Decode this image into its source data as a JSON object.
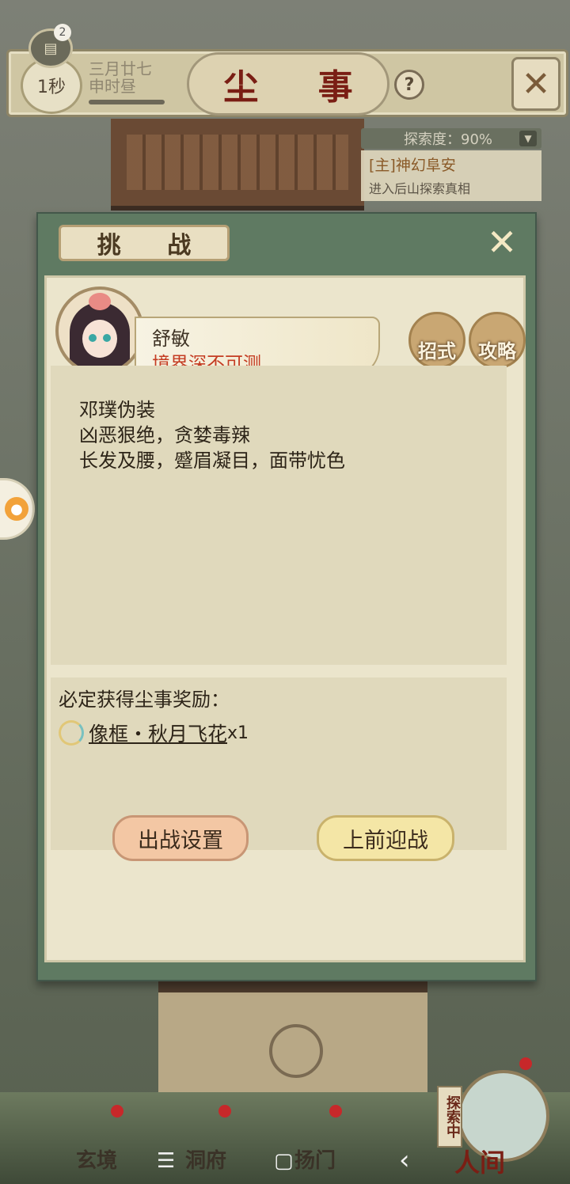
{
  "header": {
    "chat_count": "2",
    "timer": "1秒",
    "date_line1": "三月廿七",
    "date_line2": "申时昼",
    "title": "尘 事",
    "help": "?"
  },
  "explore": {
    "label": "探索度：90%"
  },
  "quest": {
    "title": "[主]神幻阜安",
    "desc": "进入后山探索真相"
  },
  "dialog": {
    "title": "挑 战",
    "npc_name": "舒敏",
    "npc_realm": "境界深不可测",
    "btn_moves": "招式",
    "btn_guide": "攻略",
    "description": [
      "邓璞伪装",
      "凶恶狠绝，贪婪毒辣",
      "长发及腰，蹙眉凝目，面带忧色"
    ],
    "reward_title": "必定获得尘事奖励：",
    "reward_item": "像框・秋月飞花",
    "reward_qty": "x1",
    "btn_setup": "出战设置",
    "btn_fight": "上前迎战"
  },
  "bottom_nav": {
    "items": [
      "玄境",
      "洞府",
      "扬门"
    ],
    "main": "人间",
    "explore_tag": "探索中"
  },
  "system_nav": {
    "menu": "☰",
    "home": "▢",
    "back": "‹"
  },
  "colors": {
    "accent": "#7a1e14",
    "realm": "#c43c22",
    "panel": "#5f7a62"
  }
}
